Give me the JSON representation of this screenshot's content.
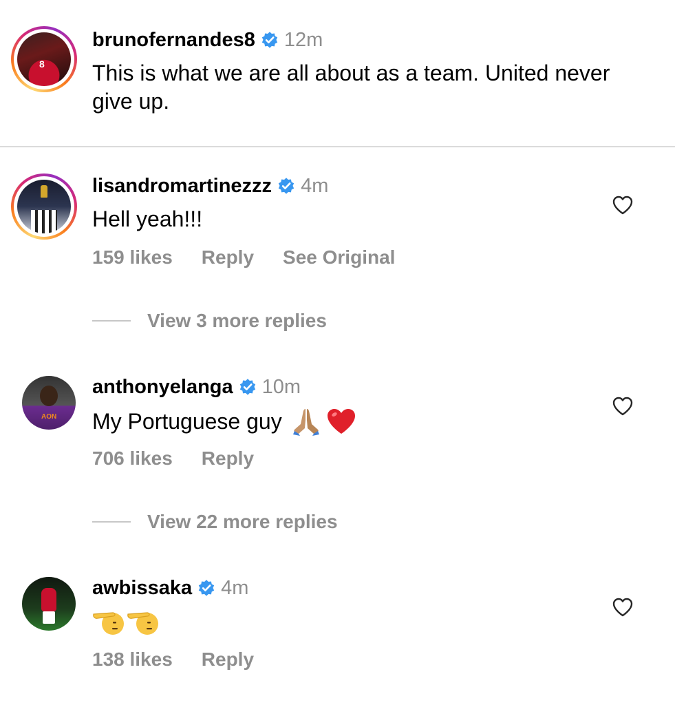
{
  "caption": {
    "username": "brunofernandes8",
    "time": "12m",
    "text": "This is what we are all about as a team. United never give up.",
    "avatar_number": "8"
  },
  "comments": [
    {
      "username": "lisandromartinezzz",
      "time": "4m",
      "text": "Hell yeah!!!",
      "likes": "159 likes",
      "reply_label": "Reply",
      "see_original_label": "See Original",
      "view_replies": "View 3 more replies"
    },
    {
      "username": "anthonyelanga",
      "time": "10m",
      "text": "My Portuguese guy",
      "emojis": [
        "folded-hands",
        "red-heart"
      ],
      "likes": "706 likes",
      "reply_label": "Reply",
      "view_replies": "View 22 more replies",
      "avatar_sponsor": "AON"
    },
    {
      "username": "awbissaka",
      "time": "4m",
      "text": "",
      "emojis": [
        "saluting-face",
        "saluting-face"
      ],
      "likes": "138 likes",
      "reply_label": "Reply"
    }
  ],
  "icons": {
    "verified": "verified-badge-icon",
    "heart": "heart-outline-icon"
  },
  "colors": {
    "verified_blue": "#3897f0",
    "secondary_text": "#8e8e8e",
    "divider": "#dbdbdb"
  }
}
